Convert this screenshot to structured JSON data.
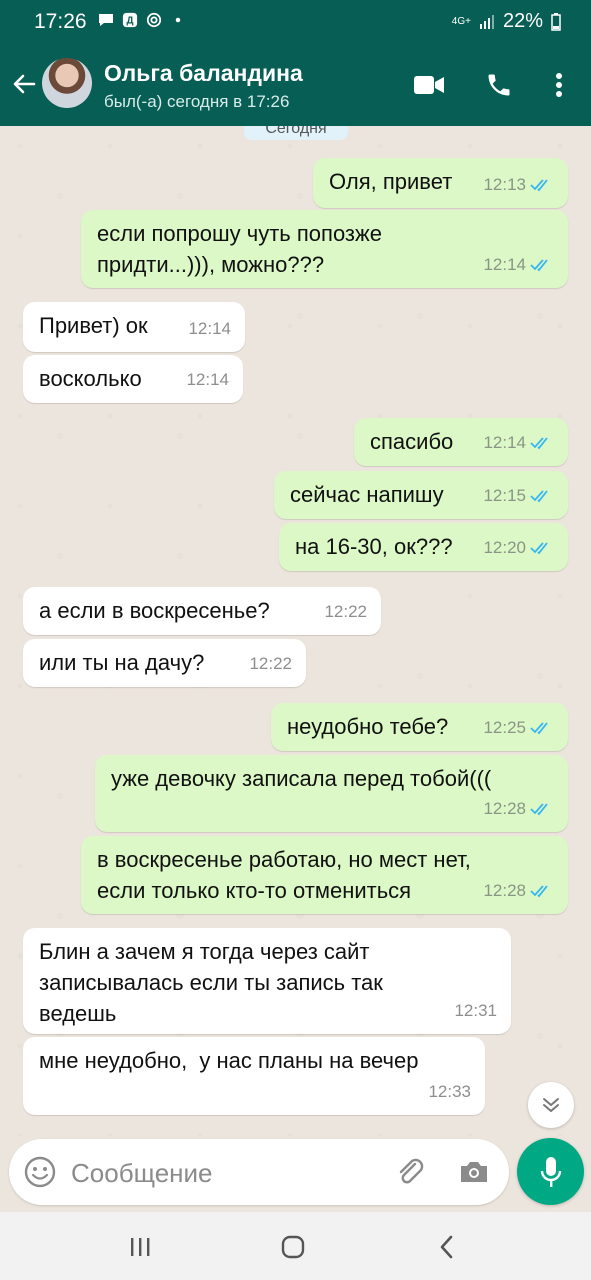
{
  "status_bar": {
    "time": "17:26",
    "network": "4G+",
    "battery": "22%"
  },
  "header": {
    "contact_name": "Ольга баландина",
    "contact_status": "был(-а) сегодня в 17:26"
  },
  "chat": {
    "date_chip": "Сегодня",
    "messages": [
      {
        "direction": "out",
        "text": "Оля, привет",
        "time": "12:13"
      },
      {
        "direction": "out",
        "text": "если попрошу чуть попозже\nпридти...))), можно???",
        "time": "12:14"
      },
      {
        "direction": "in",
        "text": "Привет) ок",
        "time": "12:14"
      },
      {
        "direction": "in",
        "text": "восколько",
        "time": "12:14"
      },
      {
        "direction": "out",
        "text": "спасибо",
        "time": "12:14"
      },
      {
        "direction": "out",
        "text": "сейчас напишу",
        "time": "12:15"
      },
      {
        "direction": "out",
        "text": "на 16-30, ок???",
        "time": "12:20"
      },
      {
        "direction": "in",
        "text": "а если в воскресенье?",
        "time": "12:22"
      },
      {
        "direction": "in",
        "text": "или ты на дачу?",
        "time": "12:22"
      },
      {
        "direction": "out",
        "text": "неудобно тебе?",
        "time": "12:25"
      },
      {
        "direction": "out",
        "text": "уже девочку записала перед тобой(((",
        "time": "12:28"
      },
      {
        "direction": "out",
        "text": "в воскресенье работаю, но мест нет,\nесли только кто-то отмениться",
        "time": "12:28"
      },
      {
        "direction": "in",
        "text": "Блин а зачем я тогда через сайт\nзаписывалась если ты запись так\nведешь",
        "time": "12:31"
      },
      {
        "direction": "in",
        "text": "мне неудобно,  у нас планы на вечер",
        "time": "12:33"
      }
    ]
  },
  "input": {
    "placeholder": "Сообщение"
  },
  "colors": {
    "header": "#075e54",
    "outgoing_bubble": "#dcf8c6",
    "incoming_bubble": "#ffffff",
    "read_ticks": "#34b7f1",
    "mic_button": "#00a884"
  }
}
